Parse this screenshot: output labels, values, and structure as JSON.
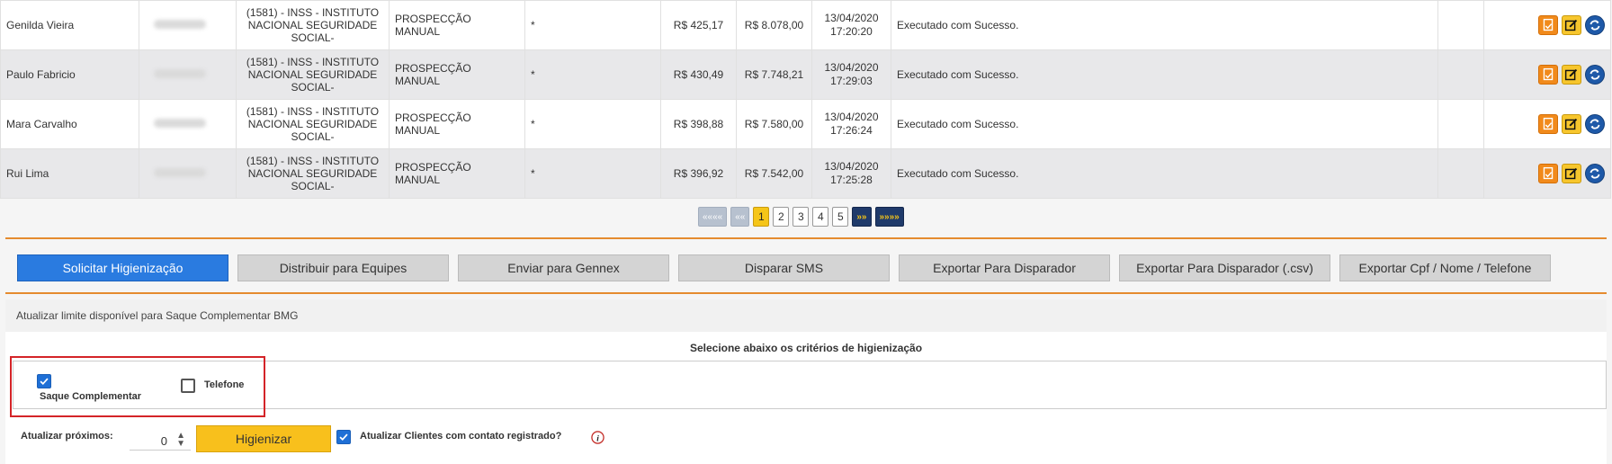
{
  "table": {
    "rows": [
      {
        "name": "Genilda Vieira",
        "organ": [
          "(1581) - INSS - INSTITUTO",
          "NACIONAL SEGURIDADE",
          "SOCIAL-"
        ],
        "origin": "PROSPECÇÃO MANUAL",
        "star": "*",
        "v1": "R$ 425,17",
        "v2": "R$ 8.078,00",
        "date": "13/04/2020",
        "time": "17:20:20",
        "status": "Executado com Sucesso."
      },
      {
        "name": "Paulo Fabricio",
        "organ": [
          "(1581) - INSS - INSTITUTO",
          "NACIONAL SEGURIDADE",
          "SOCIAL-"
        ],
        "origin": "PROSPECÇÃO MANUAL",
        "star": "*",
        "v1": "R$ 430,49",
        "v2": "R$ 7.748,21",
        "date": "13/04/2020",
        "time": "17:29:03",
        "status": "Executado com Sucesso."
      },
      {
        "name": "Mara Carvalho",
        "organ": [
          "(1581) - INSS - INSTITUTO",
          "NACIONAL SEGURIDADE",
          "SOCIAL-"
        ],
        "origin": "PROSPECÇÃO MANUAL",
        "star": "*",
        "v1": "R$ 398,88",
        "v2": "R$ 7.580,00",
        "date": "13/04/2020",
        "time": "17:26:24",
        "status": "Executado com Sucesso."
      },
      {
        "name": "Rui Lima",
        "organ": [
          "(1581) - INSS - INSTITUTO",
          "NACIONAL SEGURIDADE",
          "SOCIAL-"
        ],
        "origin": "PROSPECÇÃO MANUAL",
        "star": "*",
        "v1": "R$ 396,92",
        "v2": "R$ 7.542,00",
        "date": "13/04/2020",
        "time": "17:25:28",
        "status": "Executado com Sucesso."
      }
    ],
    "row_actions": [
      "document-check-icon",
      "edit-icon",
      "refresh-icon"
    ]
  },
  "pagination": {
    "first": "««««",
    "prev": "««",
    "pages": [
      "1",
      "2",
      "3",
      "4",
      "5"
    ],
    "current": "1",
    "next": "»»",
    "last": "»»»»"
  },
  "actions": {
    "solicitar": "Solicitar Higienização",
    "distribuir": "Distribuir para Equipes",
    "enviar": "Enviar para Gennex",
    "sms": "Disparar SMS",
    "exportar": "Exportar Para Disparador",
    "exportar_csv": "Exportar Para Disparador (.csv)",
    "exportar_cpf": "Exportar Cpf / Nome / Telefone"
  },
  "limit_strip": "Atualizar limite disponível para Saque Complementar BMG",
  "criteria": {
    "title": "Selecione abaixo os critérios de higienização",
    "saque_label": "Saque Complementar",
    "saque_checked": true,
    "telefone_label": "Telefone",
    "telefone_checked": false
  },
  "bottom": {
    "proximos_label": "Atualizar próximos:",
    "proximos_value": "0",
    "higienizar": "Higienizar",
    "contato_label": "Atualizar Clientes com contato registrado?",
    "contato_checked": true
  },
  "colors": {
    "primary_blue": "#2a7be0",
    "accent_orange": "#e58b2f",
    "highlight_red": "#d42428",
    "button_yellow": "#f8c01c"
  }
}
